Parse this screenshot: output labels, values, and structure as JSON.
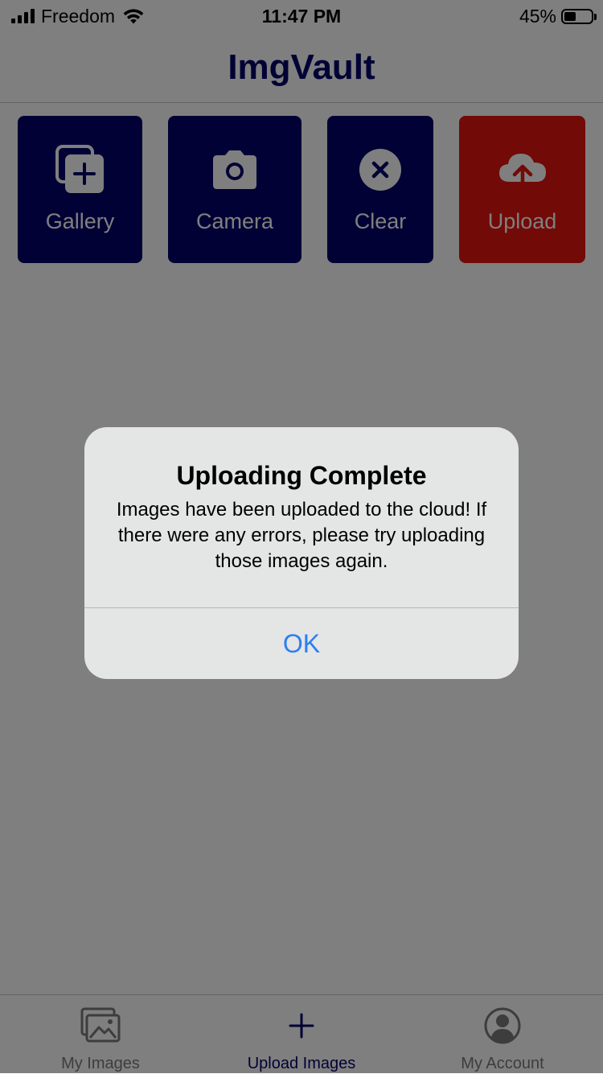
{
  "status_bar": {
    "carrier": "Freedom",
    "time": "11:47 PM",
    "battery_percent_label": "45%",
    "battery_level": 0.45
  },
  "header": {
    "title": "ImgVault"
  },
  "actions": [
    {
      "label": "Gallery",
      "icon": "gallery-add-icon",
      "color": "#02036b"
    },
    {
      "label": "Camera",
      "icon": "camera-icon",
      "color": "#02036b"
    },
    {
      "label": "Clear",
      "icon": "close-circle-icon",
      "color": "#02036b"
    },
    {
      "label": "Upload",
      "icon": "cloud-upload-icon",
      "color": "#e5140f"
    }
  ],
  "tabs": [
    {
      "label": "My Images",
      "icon": "images-icon",
      "active": false
    },
    {
      "label": "Upload Images",
      "icon": "plus-icon",
      "active": true
    },
    {
      "label": "My Account",
      "icon": "account-icon",
      "active": false
    }
  ],
  "alert": {
    "title": "Uploading Complete",
    "message": "Images have been uploaded to the cloud! If there were any errors, please try uploading those images again.",
    "button_label": "OK"
  },
  "colors": {
    "brand": "#02036b",
    "danger": "#e5140f",
    "alert_button": "#2c7ef4",
    "alert_background": "#e4e5e5"
  }
}
